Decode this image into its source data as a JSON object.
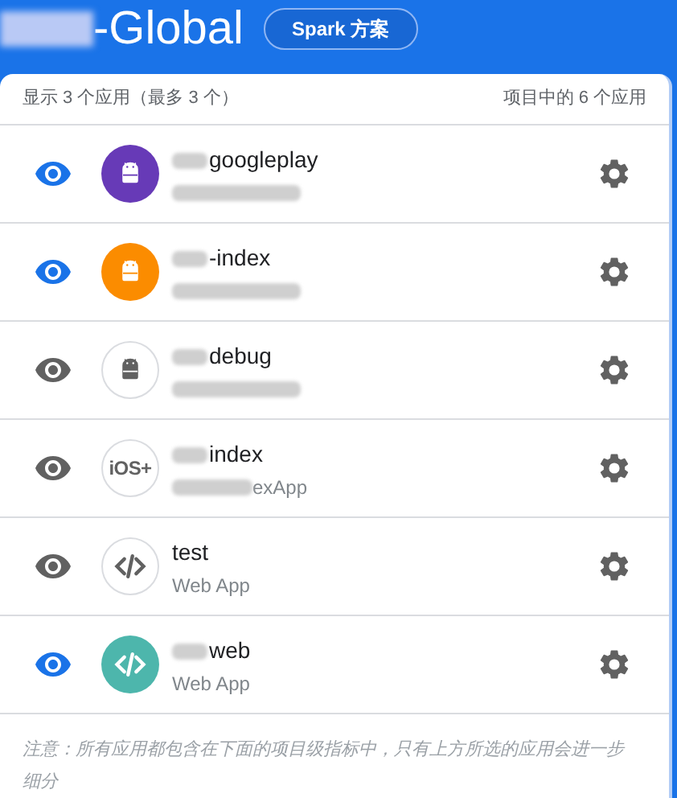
{
  "header": {
    "title": "-Global",
    "title_blurred_prefix": true,
    "plan_badge": "Spark 方案"
  },
  "summary": {
    "left": "显示 3 个应用（最多 3 个）",
    "right": "项目中的 6 个应用"
  },
  "apps": [
    {
      "name": "googleplay",
      "name_blurred_prefix": true,
      "subtitle_blurred": true,
      "shown": true,
      "avatar": {
        "kind": "android",
        "color": "#673ab7"
      }
    },
    {
      "name": "-index",
      "name_blurred_prefix": true,
      "subtitle_blurred": true,
      "shown": true,
      "avatar": {
        "kind": "android",
        "color": "#fb8c00"
      }
    },
    {
      "name": "debug",
      "name_blurred_prefix": true,
      "subtitle_blurred": true,
      "shown": false,
      "avatar": {
        "kind": "android"
      }
    },
    {
      "name": "index",
      "name_blurred_prefix": true,
      "subtitle": "exApp",
      "subtitle_blurred": true,
      "shown": false,
      "avatar": {
        "kind": "ios",
        "label": "iOS+"
      }
    },
    {
      "name": "test",
      "name_blurred_prefix": false,
      "subtitle": "Web App",
      "subtitle_blurred": false,
      "shown": false,
      "avatar": {
        "kind": "web"
      }
    },
    {
      "name": "web",
      "name_blurred_prefix": true,
      "subtitle": "Web App",
      "subtitle_blurred": false,
      "shown": true,
      "avatar": {
        "kind": "web",
        "color": "#4db6ac"
      }
    }
  ],
  "note": "注意：所有应用都包含在下面的项目级指标中，只有上方所选的应用会进一步细分"
}
